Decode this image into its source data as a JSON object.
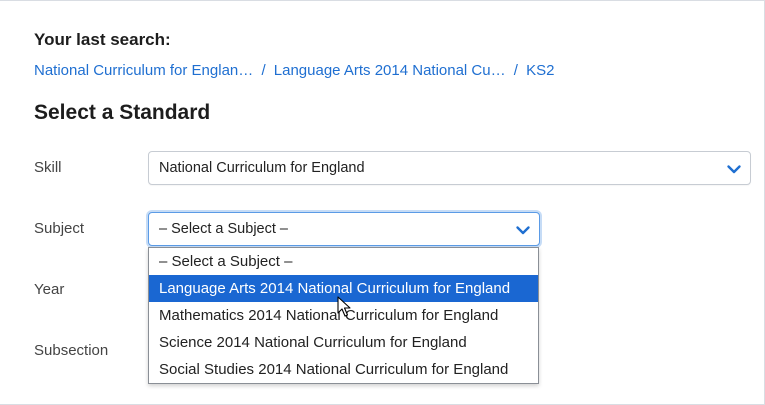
{
  "last_search": {
    "title": "Your last search:",
    "breadcrumb": [
      "National Curriculum for Englan…",
      "Language Arts 2014 National Cu…",
      "KS2"
    ],
    "separator": "/"
  },
  "form": {
    "title": "Select a Standard",
    "skill": {
      "label": "Skill",
      "value": "National Curriculum for England"
    },
    "subject": {
      "label": "Subject",
      "value": "– Select a Subject –",
      "options": [
        "– Select a Subject –",
        "Language Arts 2014 National Curriculum for England",
        "Mathematics 2014 National Curriculum for England",
        "Science 2014 National Curriculum for England",
        "Social Studies 2014 National Curriculum for England"
      ],
      "highlighted_index": 1
    },
    "year": {
      "label": "Year"
    },
    "subsection": {
      "label": "Subsection"
    }
  },
  "colors": {
    "link": "#1f6fd1",
    "highlight": "#1a67d2",
    "chevron": "#1f6fd1"
  },
  "icons": {
    "skill_chevron": "chevron-down-icon",
    "subject_chevron": "chevron-down-icon",
    "cursor": "mouse-pointer-icon"
  }
}
